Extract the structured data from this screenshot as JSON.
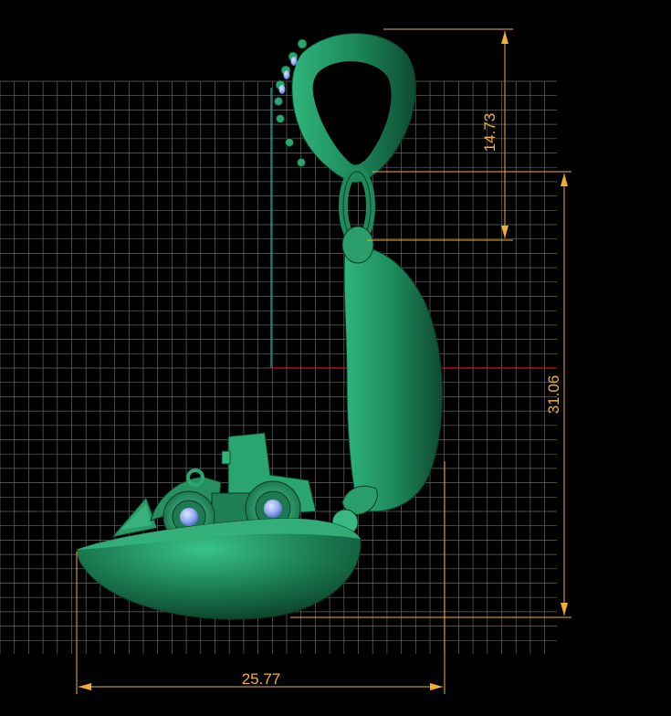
{
  "viewport": {
    "background": "#000000",
    "grid_color": "#8a8a8a",
    "model_color": "#1f8a5c",
    "model_shadow": "#0d4a30",
    "gem_color": "#9fb8ff",
    "axis_x_color": "#d01010",
    "axis_y_color": "#20a0a0"
  },
  "dimensions": {
    "color": "#f0b030",
    "bail_height": "14.73",
    "total_height": "31.06",
    "width": "25.77"
  }
}
